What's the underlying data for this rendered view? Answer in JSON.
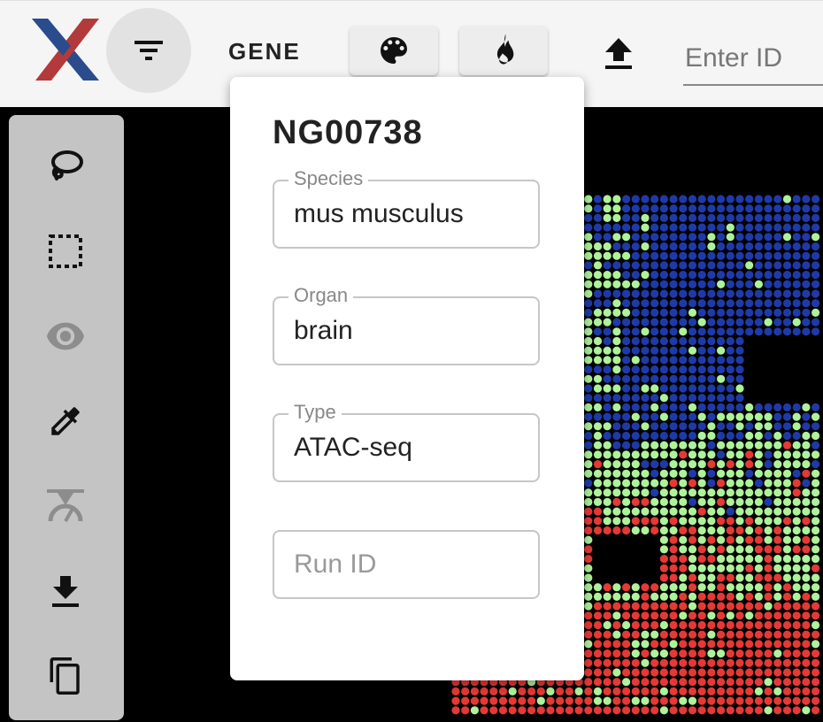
{
  "app": {
    "logo_icon": "x-logo-icon",
    "colors": {
      "logo_red": "#b33a3a",
      "logo_blue": "#2b4c8c",
      "blue": "#1f3aa8",
      "green": "#aef29a",
      "red": "#e53935"
    }
  },
  "toolbar": {
    "filter_icon": "filter-icon",
    "gene_label": "GENE",
    "palette_icon": "palette-icon",
    "fire_icon": "fire-icon",
    "upload_icon": "upload-icon",
    "id_placeholder": "Enter ID"
  },
  "sidebar": {
    "items": [
      {
        "icon": "lasso-icon"
      },
      {
        "icon": "rectangle-select-icon"
      },
      {
        "icon": "eye-icon",
        "disabled": true
      },
      {
        "icon": "eyedropper-icon"
      },
      {
        "icon": "gauge-icon",
        "disabled": true
      },
      {
        "icon": "download-icon"
      },
      {
        "icon": "copy-icon"
      }
    ]
  },
  "popover": {
    "title": "NG00738",
    "species": {
      "label": "Species",
      "value": "mus musculus"
    },
    "organ": {
      "label": "Organ",
      "value": "brain"
    },
    "type": {
      "label": "Type",
      "value": "ATAC-seq"
    },
    "run_id": {
      "placeholder": "Run ID"
    }
  }
}
